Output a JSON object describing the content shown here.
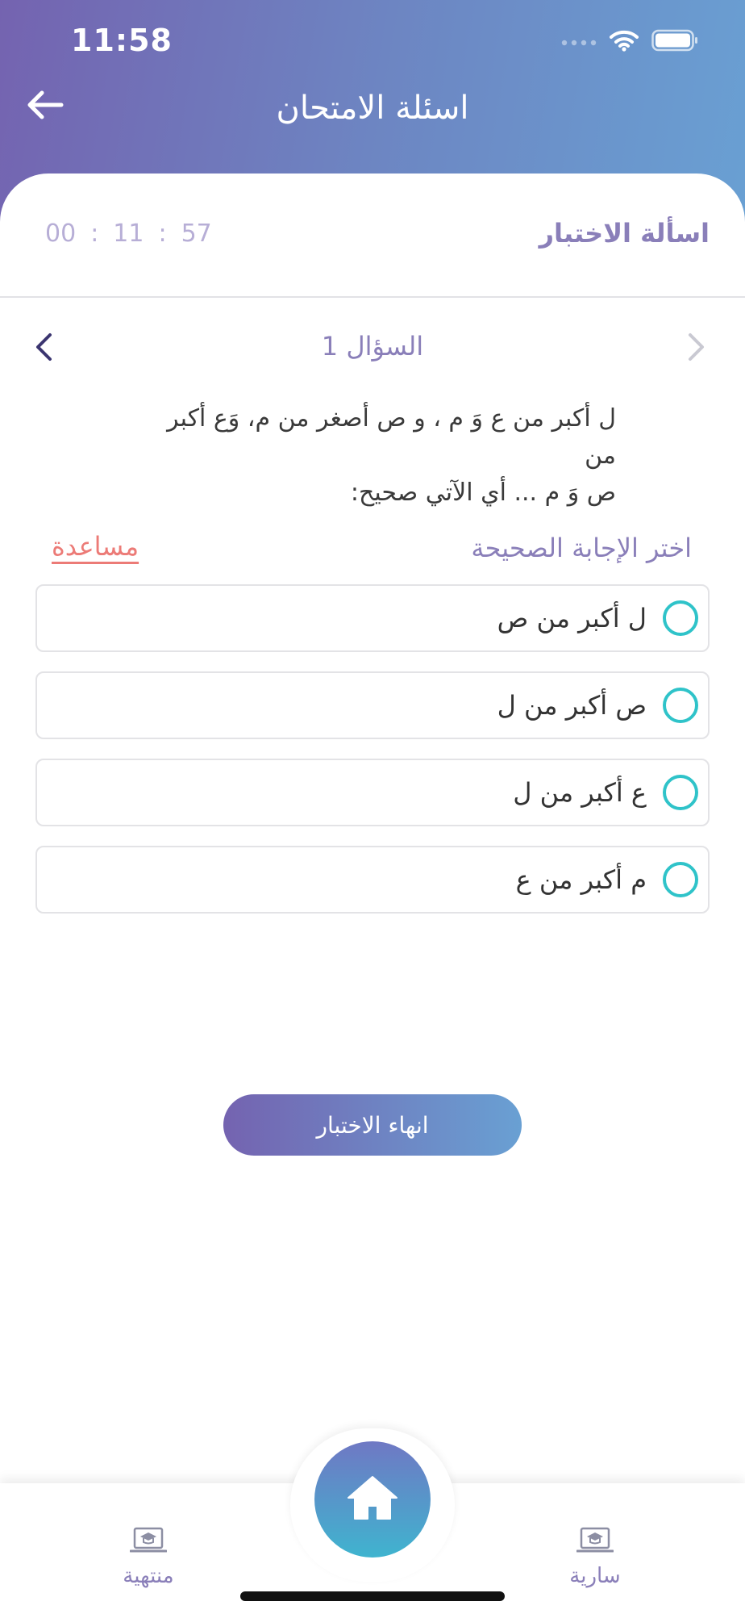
{
  "status_bar": {
    "time": "11:58",
    "signal_icon": "signal-dots-icon",
    "wifi_icon": "wifi-icon",
    "battery_icon": "battery-icon"
  },
  "header": {
    "title": "اسئلة الامتحان",
    "back_icon": "arrow-left-icon"
  },
  "exam": {
    "section_title": "اسألة الاختبار",
    "timer": {
      "hours": "00",
      "minutes": "11",
      "seconds": "57",
      "separator": ":"
    }
  },
  "question": {
    "number_label": "السؤال 1",
    "text_line1": "ل أكبر من ع وَ م ، و ص أصغر من م، وَع أكبر من",
    "text_line2": "ص وَ م ... أي الآتي صحيح:",
    "choose_label": "اختر الإجابة الصحيحة",
    "help_label": "مساعدة",
    "options": [
      {
        "label": "ل أكبر من ص"
      },
      {
        "label": "ص أكبر من ل"
      },
      {
        "label": "ع أكبر من ل"
      },
      {
        "label": "م أكبر من ع"
      }
    ]
  },
  "end_button_label": "انهاء الاختبار",
  "tabbar": {
    "ended_label": "منتهية",
    "ongoing_label": "سارية",
    "home_icon": "home-icon",
    "tab_icon": "laptop-graduation-icon"
  },
  "colors": {
    "header_gradient_start": "#7463b0",
    "header_gradient_end": "#69a0d3",
    "accent_purple": "#8a7fb9",
    "radio_teal": "#2fc3c9",
    "help_red": "#ec7b77"
  }
}
